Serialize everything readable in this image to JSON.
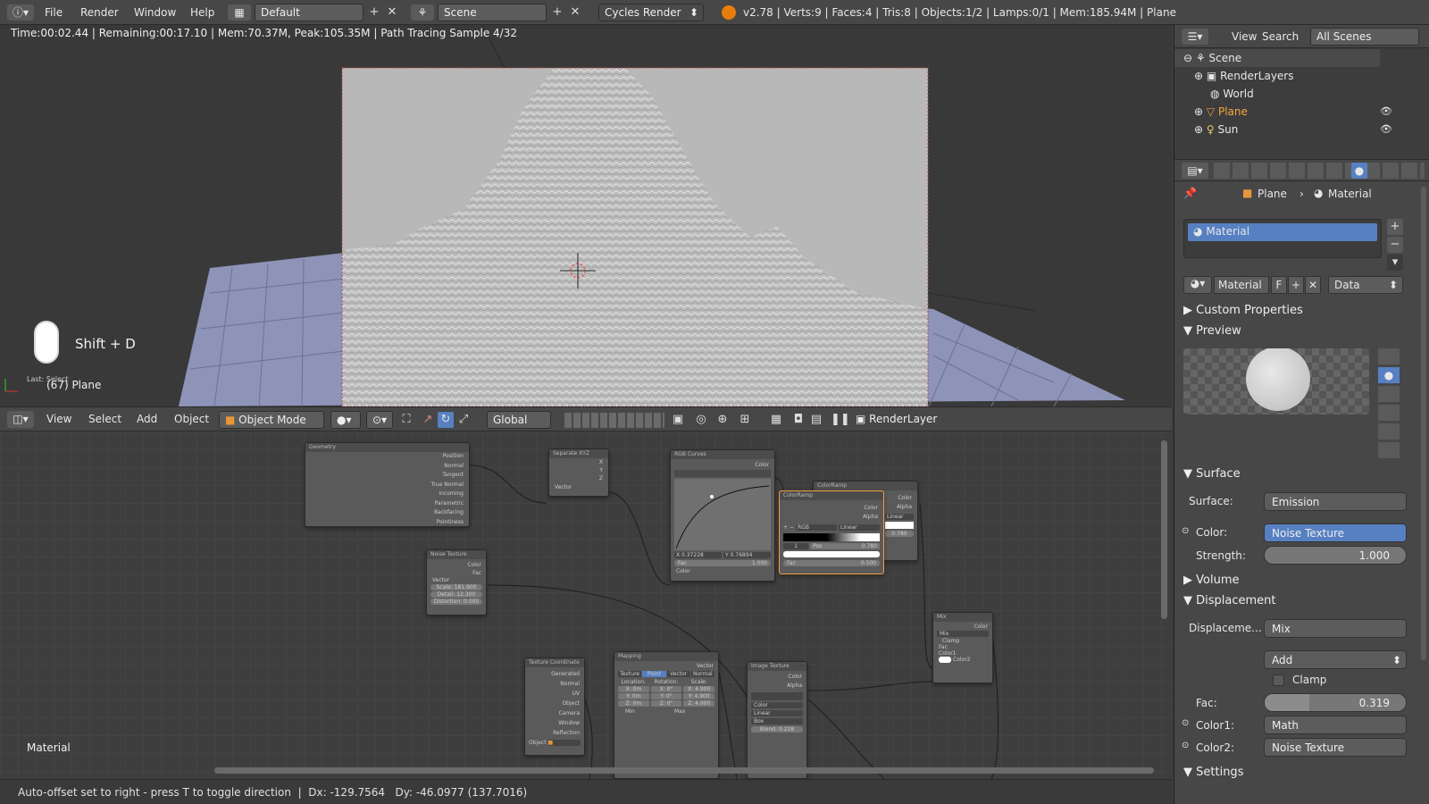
{
  "topbar": {
    "menu": [
      "File",
      "Render",
      "Window",
      "Help"
    ],
    "screen_layout": "Default",
    "scene": "Scene",
    "engine": "Cycles Render",
    "stats": "v2.78 | Verts:9 | Faces:4 | Tris:8 | Objects:1/2 | Lamps:0/1 | Mem:185.94M | Plane"
  },
  "viewport": {
    "render_info": "Time:00:02.44 | Remaining:00:17.10 | Mem:70.37M, Peak:105.35M | Path Tracing Sample 4/32",
    "key_hint": "Shift + D",
    "last_op": "Last: Select",
    "object_label": "(67) Plane"
  },
  "view3d_header": {
    "menus": [
      "View",
      "Select",
      "Add",
      "Object"
    ],
    "mode": "Object Mode",
    "orientation": "Global",
    "render_layer": "RenderLayer"
  },
  "node_editor": {
    "material_label": "Material",
    "nodes": {
      "geometry": {
        "title": "Geometry",
        "outputs": [
          "Position",
          "Normal",
          "Tangent",
          "True Normal",
          "Incoming",
          "Parametric",
          "Backfacing",
          "Pointiness"
        ]
      },
      "separate_xyz": {
        "title": "Separate XYZ",
        "outputs": [
          "X",
          "Y",
          "Z"
        ],
        "input": "Vector"
      },
      "rgb_curves": {
        "title": "RGB Curves",
        "output": "Color",
        "x_val": "X 0.37228",
        "y_val": "Y 0.76894",
        "fac": "Fac",
        "fac_val": "1.000",
        "color": "Color"
      },
      "colorramp_back": {
        "title": "ColorRamp",
        "outputs": [
          "Color",
          "Alpha"
        ],
        "mode": "Linear",
        "pos": "0.780"
      },
      "colorramp_front": {
        "title": "ColorRamp",
        "outputs": [
          "Color",
          "Alpha"
        ],
        "rgb": "RGB",
        "interp": "Linear",
        "index": "1",
        "pos_label": "Pos",
        "pos": "0.780",
        "fac": "Fac",
        "fac_val": "0.500"
      },
      "noise": {
        "title": "Noise Texture",
        "outputs": [
          "Color",
          "Fac"
        ],
        "vector": "Vector",
        "scale": "Scale: 181.900",
        "detail": "Detail: 12.300",
        "distortion": "Distortion: 0.000"
      },
      "mix": {
        "title": "Mix",
        "output": "Color",
        "mode": "Mix",
        "clamp": "Clamp",
        "inputs": [
          "Fac",
          "Color1",
          "Color2"
        ]
      },
      "texcoord": {
        "title": "Texture Coordinate",
        "outputs": [
          "Generated",
          "Normal",
          "UV",
          "Object",
          "Camera",
          "Window",
          "Reflection"
        ],
        "object_label": "Object"
      },
      "mapping": {
        "title": "Mapping",
        "output": "Vector",
        "tabs": [
          "Texture",
          "Point",
          "Vector",
          "Normal"
        ],
        "cols": [
          "Location:",
          "Rotation:",
          "Scale:"
        ],
        "rows": [
          [
            "X: 0m",
            "X: 0°",
            "X: 4.900"
          ],
          [
            "Y: 0m",
            "Y: 0°",
            "Y: 4.900"
          ],
          [
            "Z: 0m",
            "Z: 0°",
            "Z: 4.900"
          ]
        ],
        "min": "Min",
        "max": "Max"
      },
      "image": {
        "title": "Image Texture",
        "outputs": [
          "Color",
          "Alpha"
        ],
        "color": "Color",
        "linear": "Linear",
        "flat": "Box",
        "blend": "Blend: 0.228"
      }
    }
  },
  "status": {
    "message": "Auto-offset set to right - press T to toggle direction  |  Dx: -129.7564   Dy: -46.0977 (137.7016)"
  },
  "outliner": {
    "menus": [
      "View",
      "Search"
    ],
    "filter": "All Scenes",
    "items": [
      "Scene",
      "RenderLayers",
      "World",
      "Plane",
      "Sun"
    ]
  },
  "properties": {
    "breadcrumb": [
      "Plane",
      "Material"
    ],
    "slot": "Material",
    "material_name": "Material",
    "f_label": "F",
    "link": "Data",
    "panels": {
      "custom": "Custom Properties",
      "preview": "Preview",
      "surface": "Surface",
      "volume": "Volume",
      "displacement": "Displacement",
      "settings": "Settings"
    },
    "surface_label": "Surface:",
    "surface_value": "Emission",
    "color_label": "Color:",
    "color_value": "Noise Texture",
    "strength_label": "Strength:",
    "strength_value": "1.000",
    "disp_label": "Displaceme...",
    "disp_value": "Mix",
    "blend_value": "Add",
    "clamp_label": "Clamp",
    "fac_label": "Fac:",
    "fac_value": "0.319",
    "fac_fraction": 0.319,
    "color1_label": "Color1:",
    "color1_value": "Math",
    "color2_label": "Color2:",
    "color2_value": "Noise Texture"
  },
  "colors": {
    "accent_blue": "#5680c2",
    "socket_yellow": "#c7c729",
    "socket_purple": "#6363c7",
    "socket_grey": "#a1a1a1"
  }
}
